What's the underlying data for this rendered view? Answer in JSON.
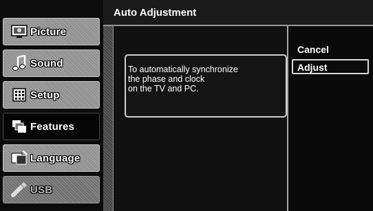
{
  "sidebar": {
    "items": [
      {
        "label": "Picture",
        "icon": "picture-icon",
        "state": "normal"
      },
      {
        "label": "Sound",
        "icon": "music-note-icon",
        "state": "normal"
      },
      {
        "label": "Setup",
        "icon": "setup-grid-icon",
        "state": "normal"
      },
      {
        "label": "Features",
        "icon": "features-icon",
        "state": "selected"
      },
      {
        "label": "Language",
        "icon": "language-flag-icon",
        "state": "normal"
      },
      {
        "label": "USB",
        "icon": "usb-icon",
        "state": "disabled"
      }
    ]
  },
  "header": {
    "title": "Auto Adjustment"
  },
  "main": {
    "info_lines": [
      "To automatically synchronize",
      "the phase and clock",
      "on the TV and PC."
    ]
  },
  "options": {
    "items": [
      {
        "label": "Cancel",
        "selected": false
      },
      {
        "label": "Adjust",
        "selected": true
      }
    ]
  },
  "colors": {
    "menu_item": "#8f8f8f",
    "selected_item": "#050505",
    "background": "#000000",
    "border": "#cfcfcf"
  }
}
